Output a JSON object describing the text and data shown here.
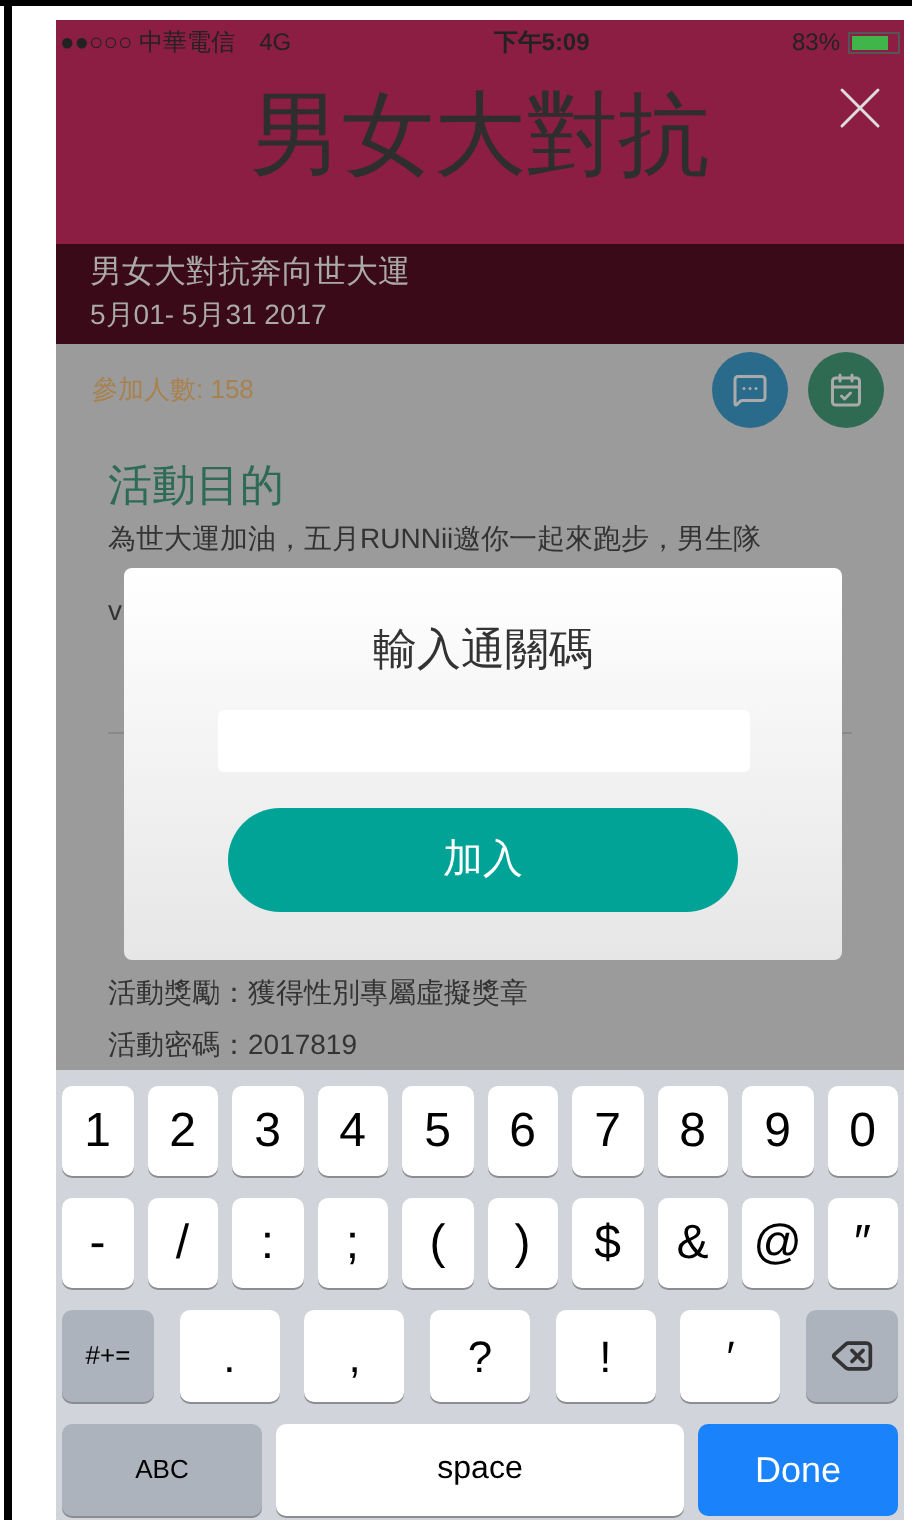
{
  "status_bar": {
    "carrier": "●●○○○ 中華電信",
    "network": "4G",
    "time": "下午5:09",
    "battery": "83%"
  },
  "banner": {
    "headline": "男女大對抗",
    "title": "男女大對抗奔向世大運",
    "dates": "5月01- 5月31 2017"
  },
  "participants": "參加人數: 158",
  "content": {
    "heading": "活動目的",
    "lines": [
      "為世大運加油，五月RUNNii邀你一起來跑步，男生隊",
      "v"
    ],
    "details": [
      "活動獎勵：獲得性別專屬虛擬獎章",
      "活動密碼：2017819"
    ]
  },
  "dialog": {
    "title": "輸入通關碼",
    "button": "加入"
  },
  "keyboard": {
    "number_keys": [
      {
        "kind": "char",
        "label": "1"
      },
      {
        "kind": "char",
        "label": "2"
      },
      {
        "kind": "char",
        "label": "3"
      },
      {
        "kind": "char",
        "label": "4"
      },
      {
        "kind": "char",
        "label": "5"
      },
      {
        "kind": "char",
        "label": "6"
      },
      {
        "kind": "char",
        "label": "7"
      },
      {
        "kind": "char",
        "label": "8"
      },
      {
        "kind": "char",
        "label": "9"
      },
      {
        "kind": "char",
        "label": "0"
      }
    ],
    "symbol_keys": [
      {
        "kind": "char",
        "label": "-"
      },
      {
        "kind": "char",
        "label": "/"
      },
      {
        "kind": "char",
        "label": ":"
      },
      {
        "kind": "char",
        "label": ";"
      },
      {
        "kind": "char",
        "label": "("
      },
      {
        "kind": "char",
        "label": ")"
      },
      {
        "kind": "char",
        "label": "$"
      },
      {
        "kind": "char",
        "label": "&"
      },
      {
        "kind": "char",
        "label": "@"
      },
      {
        "kind": "char",
        "label": "″"
      }
    ],
    "punctuation_keys": [
      {
        "kind": "function",
        "label": "#+="
      },
      {
        "kind": "wide",
        "label": "."
      },
      {
        "kind": "wide",
        "label": ","
      },
      {
        "kind": "wide",
        "label": "?"
      },
      {
        "kind": "wide",
        "label": "!"
      },
      {
        "kind": "wide",
        "label": "′"
      },
      {
        "kind": "delete"
      }
    ],
    "bottom_keys": [
      {
        "kind": "function",
        "label": "ABC"
      },
      {
        "kind": "space",
        "label": "space"
      },
      {
        "kind": "done",
        "label": "Done"
      }
    ]
  }
}
